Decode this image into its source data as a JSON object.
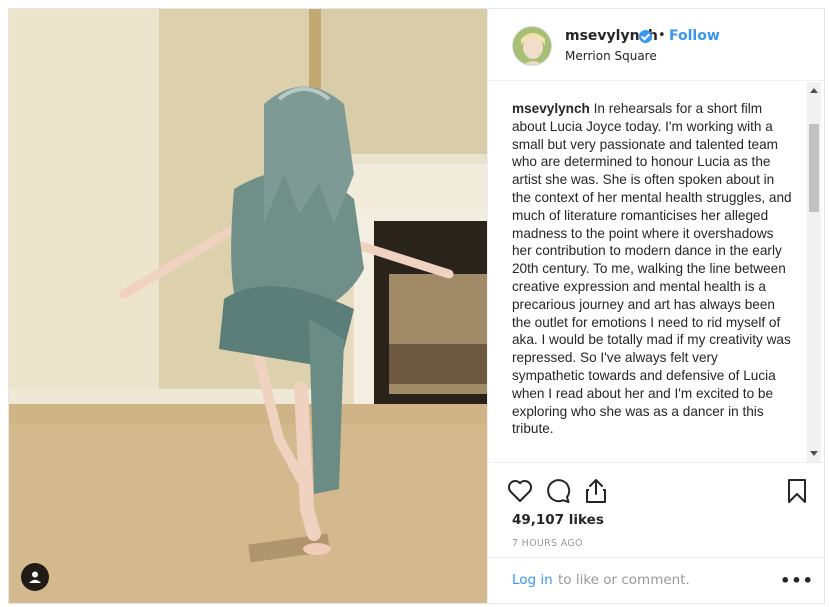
{
  "post": {
    "username": "msevylynch",
    "follow_label": "Follow",
    "separator": "•",
    "location": "Merrion Square",
    "caption_text": "In rehearsals for a short film about Lucia Joyce today. I'm working with a small but very passionate and talented team who are determined to honour Lucia as the artist she was. She is often spoken about in the context of her mental health struggles, and much of literature romanticises her alleged madness to the point where it overshadows her contribution to modern dance in the early 20th century. To me, walking the line between creative expression and mental health is a precarious journey and art has always been the outlet for emotions I need to rid myself of aka. I would be totally mad if my creativity was repressed. So I've always felt very sympathetic towards and defensive of Lucia when I read about her and I'm excited to be exploring who she was as a dancer in this tribute.",
    "likes": "49,107 likes",
    "timestamp": "7 HOURS AGO",
    "login_link": "Log in",
    "login_rest": "to like or comment.",
    "more_label": "•••"
  },
  "icons": {
    "like": "heart-icon",
    "comment": "comment-icon",
    "share": "share-icon",
    "save": "bookmark-icon",
    "user_tag": "user-icon",
    "verified": "verified-badge-icon",
    "more": "more-icon"
  },
  "colors": {
    "link": "#3897f0",
    "text": "#262626",
    "muted": "#999999",
    "border": "#efefef"
  }
}
